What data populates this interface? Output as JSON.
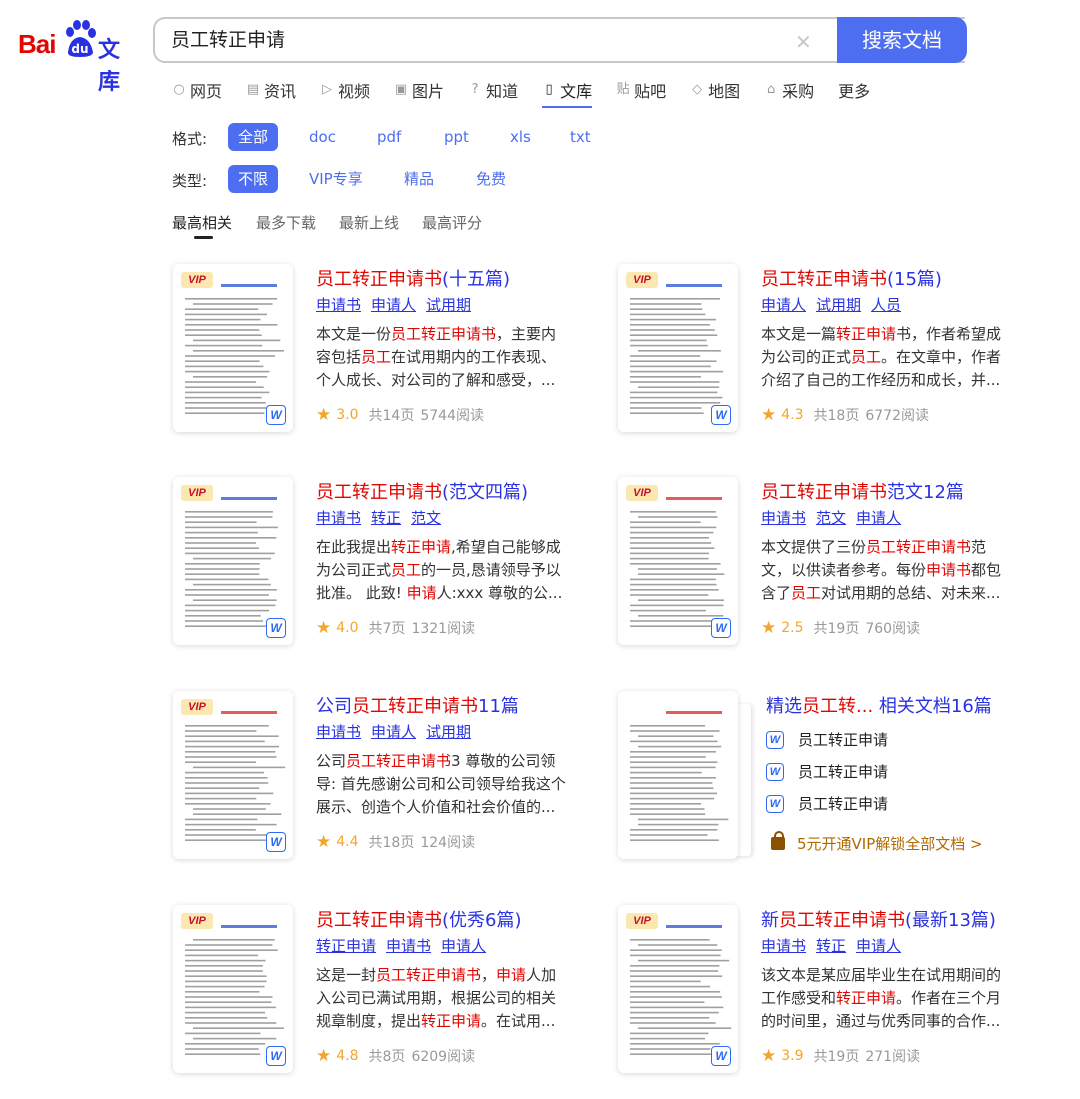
{
  "header": {
    "logo_bai": "Bai",
    "logo_wenku": "文库",
    "search_value": "员工转正申请",
    "search_button": "搜索文档"
  },
  "nav": [
    {
      "label": "网页",
      "icon": "search-icon"
    },
    {
      "label": "资讯",
      "icon": "news-icon"
    },
    {
      "label": "视频",
      "icon": "video-icon"
    },
    {
      "label": "图片",
      "icon": "image-icon"
    },
    {
      "label": "知道",
      "icon": "question-icon"
    },
    {
      "label": "文库",
      "icon": "doc-icon"
    },
    {
      "label": "贴吧",
      "icon": "tieba-icon"
    },
    {
      "label": "地图",
      "icon": "map-icon"
    },
    {
      "label": "采购",
      "icon": "shop-icon"
    },
    {
      "label": "更多",
      "icon": ""
    }
  ],
  "filters": {
    "format_label": "格式:",
    "format_options": [
      "全部",
      "doc",
      "pdf",
      "ppt",
      "xls",
      "txt"
    ],
    "type_label": "类型:",
    "type_options": [
      "不限",
      "VIP专享",
      "精品",
      "免费"
    ]
  },
  "sort": [
    "最高相关",
    "最多下载",
    "最新上线",
    "最高评分"
  ],
  "results": [
    {
      "title_pre": "",
      "title_hl": "员工转正申请书",
      "title_post": "(十五篇)",
      "tags": [
        "申请书",
        "申请人",
        "试用期"
      ],
      "desc": "本文是一份员工转正申请书，主要内容包括员工在试用期内的工作表现、个人成长、对公司的了解和感受，...",
      "rating": "3.0",
      "pages": "共14页",
      "reads": "5744阅读"
    },
    {
      "title_pre": "",
      "title_hl": "员工转正申请书",
      "title_post": "(15篇)",
      "tags": [
        "申请人",
        "试用期",
        "人员"
      ],
      "desc": "本文是一篇转正申请书，作者希望成为公司的正式员工。在文章中，作者介绍了自己的工作经历和成长，并...",
      "rating": "4.3",
      "pages": "共18页",
      "reads": "6772阅读"
    },
    {
      "title_pre": "",
      "title_hl": "员工转正申请书",
      "title_post": "(范文四篇)",
      "tags": [
        "申请书",
        "转正",
        "范文"
      ],
      "desc": "在此我提出转正申请,希望自己能够成为公司正式员工的一员,恳请领导予以批准。 此致! 申请人:xxx 尊敬的公...",
      "rating": "4.0",
      "pages": "共7页",
      "reads": "1321阅读"
    },
    {
      "title_pre": "",
      "title_hl": "员工转正申请书",
      "title_post": "范文12篇",
      "tags": [
        "申请书",
        "范文",
        "申请人"
      ],
      "desc": "本文提供了三份员工转正申请书范文，以供读者参考。每份申请书都包含了员工对试用期的总结、对未来...",
      "rating": "2.5",
      "pages": "共19页",
      "reads": "760阅读"
    },
    {
      "title_pre": "公司",
      "title_hl": "员工转正申请书",
      "title_post": "11篇",
      "tags": [
        "申请书",
        "申请人",
        "试用期"
      ],
      "desc": "公司员工转正申请书3 尊敬的公司领导: 首先感谢公司和公司领导给我这个展示、创造个人价值和社会价值的...",
      "rating": "4.4",
      "pages": "共18页",
      "reads": "124阅读"
    },
    {
      "title_pre": "",
      "title_hl": "员工转正申请书",
      "title_post": "(优秀6篇)",
      "tags": [
        "转正申请",
        "申请书",
        "申请人"
      ],
      "desc": "这是一封员工转正申请书，申请人加入公司已满试用期，根据公司的相关规章制度，提出转正申请。在试用...",
      "rating": "4.8",
      "pages": "共8页",
      "reads": "6209阅读"
    },
    {
      "title_pre": "新",
      "title_hl": "员工转正申请书",
      "title_post": "(最新13篇)",
      "tags": [
        "申请书",
        "转正",
        "申请人"
      ],
      "desc": "该文本是某应届毕业生在试用期间的工作感受和转正申请。作者在三个月的时间里，通过与优秀同事的合作...",
      "rating": "3.9",
      "pages": "共19页",
      "reads": "271阅读"
    }
  ],
  "related": {
    "title_pre": "精选",
    "title_hl": "员工转...",
    "title_post": " 相关文档16篇",
    "items": [
      "员工转正申请",
      "员工转正申请",
      "员工转正申请"
    ],
    "vip_text": "5元开通VIP解锁全部文档 >"
  },
  "colors": {
    "brand_blue": "#4e6ef2",
    "link_blue": "#2932e1",
    "highlight_red": "#e10601",
    "star": "#f4a52b"
  }
}
